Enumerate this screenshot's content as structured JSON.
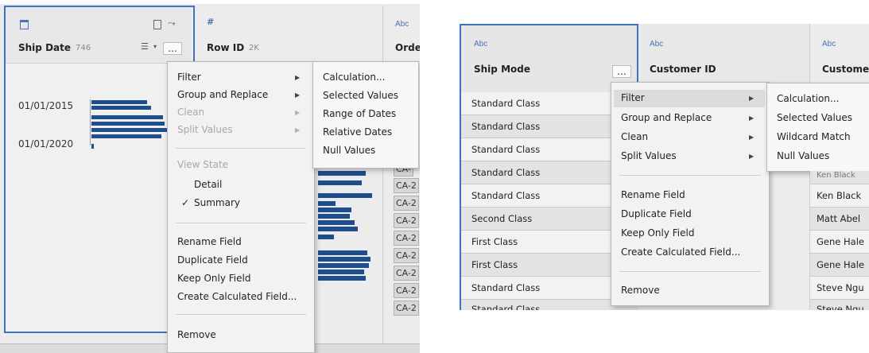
{
  "left": {
    "ship_date": {
      "type_icon": "calendar-icon",
      "label": "Ship Date",
      "count": "746"
    },
    "row_id": {
      "type_icon": "#",
      "label": "Row ID",
      "count": "2K"
    },
    "order_col": {
      "type_icon": "Abc",
      "label": "Orde"
    },
    "axis_labels": [
      "01/01/2015",
      "01/01/2020"
    ],
    "menu": {
      "more_button": "...",
      "items": [
        {
          "label": "Filter",
          "has_sub": true,
          "disabled": false
        },
        {
          "label": "Group and Replace",
          "has_sub": true,
          "disabled": false
        },
        {
          "label": "Clean",
          "has_sub": true,
          "disabled": true
        },
        {
          "label": "Split Values",
          "has_sub": true,
          "disabled": true
        }
      ],
      "view_state_label": "View State",
      "view_state_options": [
        {
          "label": "Detail",
          "checked": false
        },
        {
          "label": "Summary",
          "checked": true
        }
      ],
      "check_mark": "✓",
      "actions": [
        "Rename Field",
        "Duplicate Field",
        "Keep Only Field",
        "Create Calculated Field..."
      ],
      "remove": "Remove"
    },
    "submenu": [
      "Calculation...",
      "Selected Values",
      "Range of Dates",
      "Relative Dates",
      "Null Values"
    ],
    "ca_cells": [
      "CA-",
      "CA-2",
      "CA-2",
      "CA-2",
      "CA-2",
      "CA-2",
      "CA-2",
      "CA-2",
      "CA-2"
    ]
  },
  "right": {
    "ship_mode": {
      "type_icon": "Abc",
      "label": "Ship Mode"
    },
    "customer_id": {
      "type_icon": "Abc",
      "label": "Customer ID"
    },
    "customer_name": {
      "type_icon": "Abc",
      "label": "Custome"
    },
    "ship_mode_rows": [
      "Standard Class",
      "Standard Class",
      "Standard Class",
      "Standard Class",
      "Standard Class",
      "Second Class",
      "First Class",
      "First Class",
      "Standard Class",
      "Standard Class"
    ],
    "customer_rows": [
      "Ken Black",
      "Ken Black",
      "Matt Abel",
      "Gene Hale",
      "Gene Hale",
      "Steve Ngu",
      "Steve Ngu"
    ],
    "menu": {
      "more_button": "...",
      "items": [
        {
          "label": "Filter",
          "has_sub": true
        },
        {
          "label": "Group and Replace",
          "has_sub": true
        },
        {
          "label": "Clean",
          "has_sub": true
        },
        {
          "label": "Split Values",
          "has_sub": true
        }
      ],
      "actions": [
        "Rename Field",
        "Duplicate Field",
        "Keep Only Field",
        "Create Calculated Field..."
      ],
      "remove": "Remove"
    },
    "submenu": [
      "Calculation...",
      "Selected Values",
      "Wildcard Match",
      "Null Values"
    ]
  }
}
